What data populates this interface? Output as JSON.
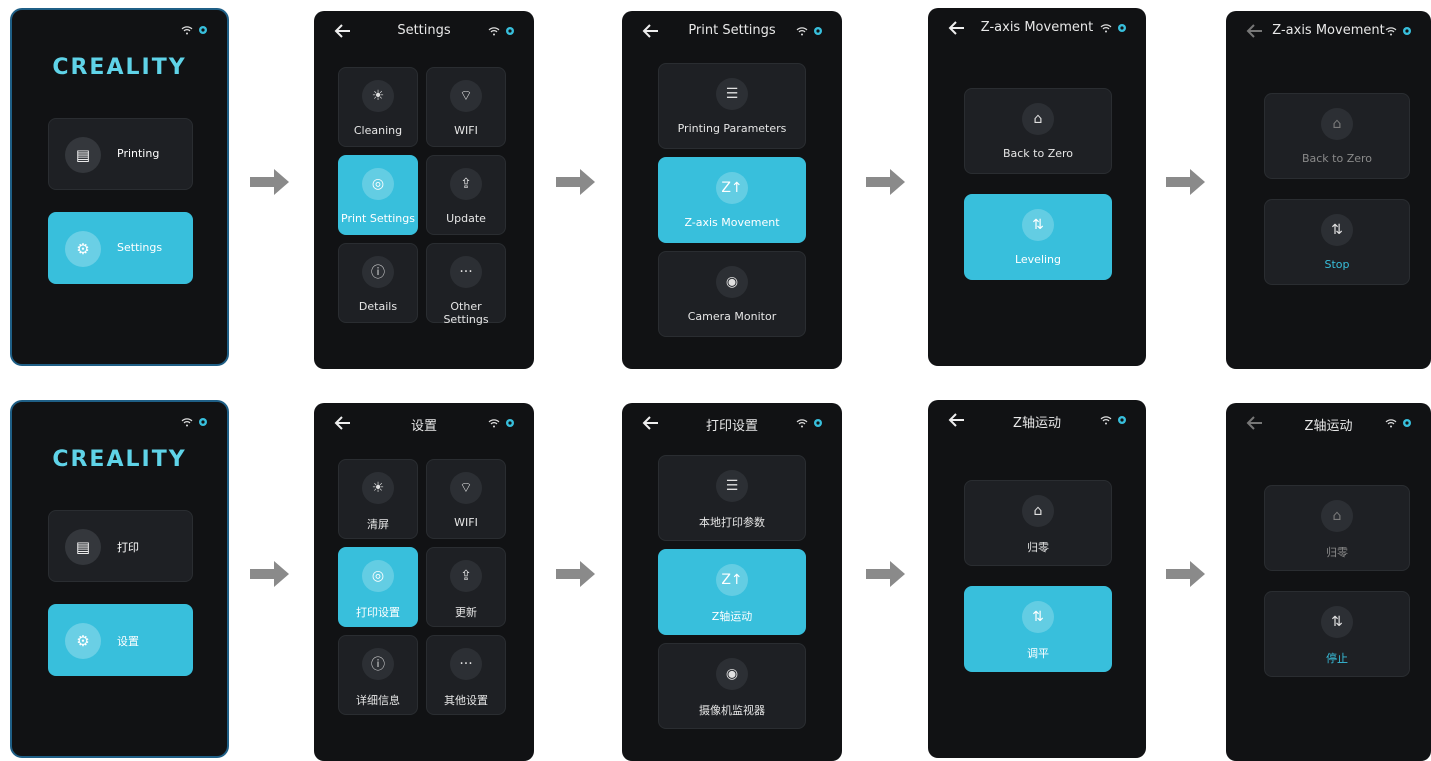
{
  "colors": {
    "accent": "#38bfdc",
    "screen_bg": "#111214",
    "tile_bg": "#1e2024",
    "arrow": "#8a8a8a"
  },
  "status_icons": [
    "wifi-icon",
    "camera-icon"
  ],
  "rows": [
    {
      "home": {
        "logo": "CREALITY",
        "items": [
          {
            "label": "Printing",
            "icon": "file-icon"
          },
          {
            "label": "Settings",
            "icon": "gear-icon",
            "active": true
          }
        ]
      },
      "settings": {
        "title": "Settings",
        "tiles": [
          {
            "label": "Cleaning",
            "icon": "bulb-icon"
          },
          {
            "label": "WIFI",
            "icon": "wifi-icon"
          },
          {
            "label": "Print Settings",
            "icon": "print-settings-icon",
            "active": true
          },
          {
            "label": "Update",
            "icon": "update-icon"
          },
          {
            "label": "Details",
            "icon": "info-icon"
          },
          {
            "label": "Other Settings",
            "icon": "more-icon"
          }
        ]
      },
      "print_settings": {
        "title": "Print Settings",
        "tiles": [
          {
            "label": "Printing Parameters",
            "icon": "sliders-icon"
          },
          {
            "label": "Z-axis Movement",
            "icon": "z-axis-icon",
            "active": true
          },
          {
            "label": "Camera Monitor",
            "icon": "camera-icon"
          }
        ]
      },
      "z_axis": {
        "title": "Z-axis Movement",
        "tiles": [
          {
            "label": "Back to Zero",
            "icon": "home-zero-icon"
          },
          {
            "label": "Leveling",
            "icon": "leveling-icon",
            "active": true
          }
        ]
      },
      "z_axis_running": {
        "title": "Z-axis Movement",
        "tiles": [
          {
            "label": "Back to Zero",
            "icon": "home-zero-icon",
            "dim": true
          },
          {
            "label": "Stop",
            "icon": "leveling-icon",
            "stop": true
          }
        ]
      }
    },
    {
      "home": {
        "logo": "CREALITY",
        "items": [
          {
            "label": "打印",
            "icon": "file-icon"
          },
          {
            "label": "设置",
            "icon": "gear-icon",
            "active": true
          }
        ]
      },
      "settings": {
        "title": "设置",
        "tiles": [
          {
            "label": "清屏",
            "icon": "bulb-icon"
          },
          {
            "label": "WIFI",
            "icon": "wifi-icon"
          },
          {
            "label": "打印设置",
            "icon": "print-settings-icon",
            "active": true
          },
          {
            "label": "更新",
            "icon": "update-icon"
          },
          {
            "label": "详细信息",
            "icon": "info-icon"
          },
          {
            "label": "其他设置",
            "icon": "more-icon"
          }
        ]
      },
      "print_settings": {
        "title": "打印设置",
        "tiles": [
          {
            "label": "本地打印参数",
            "icon": "sliders-icon"
          },
          {
            "label": "Z轴运动",
            "icon": "z-axis-icon",
            "active": true
          },
          {
            "label": "摄像机监视器",
            "icon": "camera-icon"
          }
        ]
      },
      "z_axis": {
        "title": "Z轴运动",
        "tiles": [
          {
            "label": "归零",
            "icon": "home-zero-icon"
          },
          {
            "label": "调平",
            "icon": "leveling-icon",
            "active": true
          }
        ]
      },
      "z_axis_running": {
        "title": "Z轴运动",
        "tiles": [
          {
            "label": "归零",
            "icon": "home-zero-icon",
            "dim": true
          },
          {
            "label": "停止",
            "icon": "leveling-icon",
            "stop": true
          }
        ]
      }
    }
  ]
}
